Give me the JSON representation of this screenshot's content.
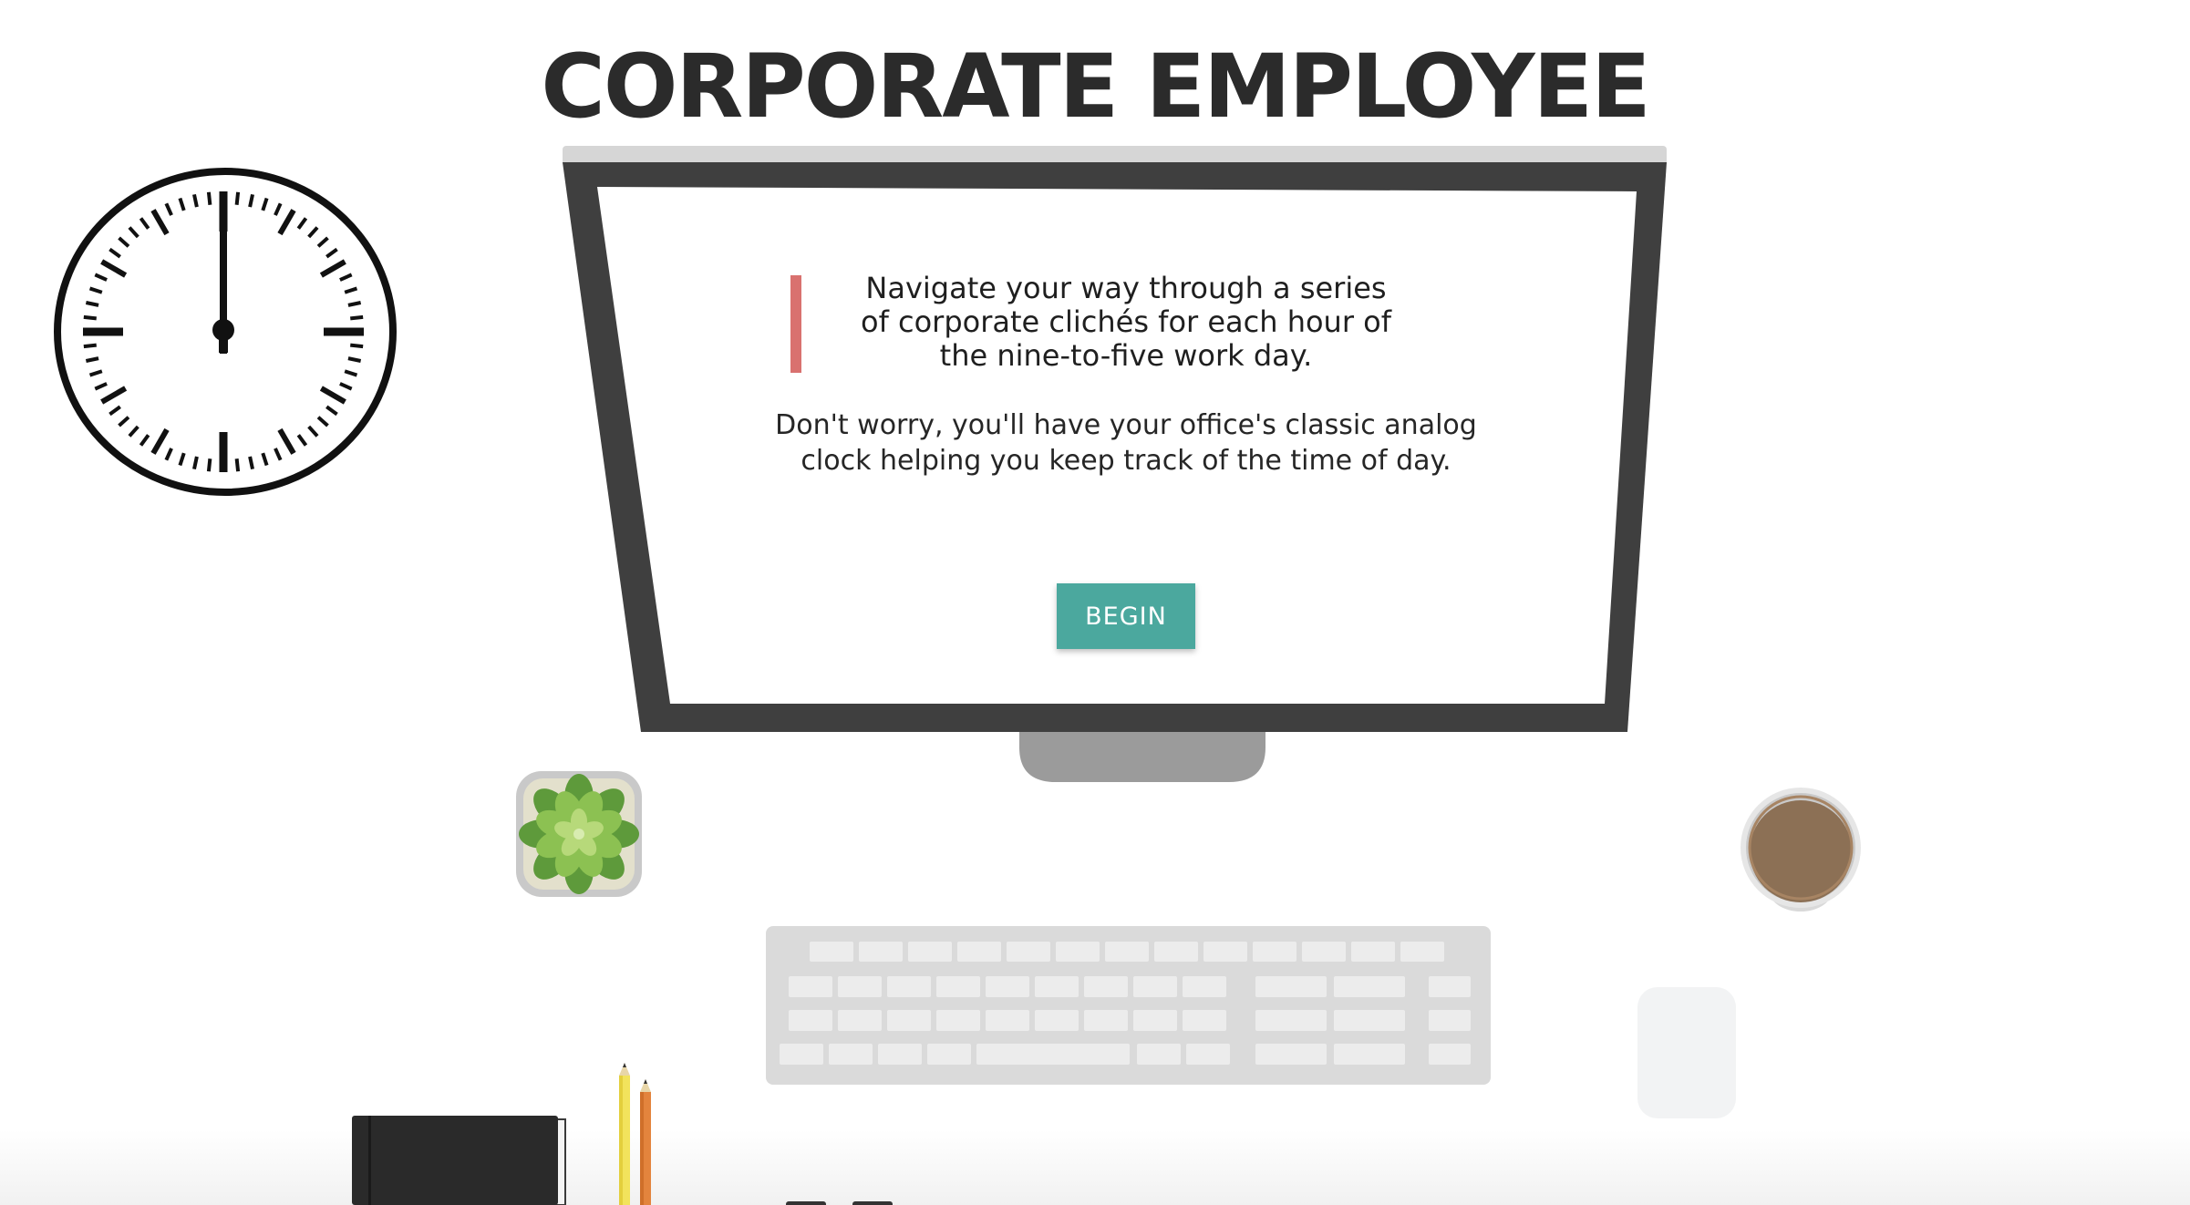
{
  "header": {
    "title": "CORPORATE EMPLOYEE"
  },
  "intro": {
    "headline": "Navigate your way through a series of corporate clichés for each hour of the nine-to-five work day.",
    "subtext": "Don't worry, you'll have your office's classic analog clock helping you keep track of the time of day.",
    "begin_label": "BEGIN"
  },
  "clock": {
    "time": "12:00"
  },
  "colors": {
    "accent": "#d9716f",
    "button": "#4ba89e",
    "monitor_bezel": "#3f3f3f",
    "coffee": "#8c7055"
  },
  "icons": {
    "clock": "wall-clock-icon",
    "plant": "succulent-plant-icon",
    "coffee": "coffee-cup-icon",
    "keyboard": "keyboard-icon",
    "mouse": "mouse-icon",
    "notebook": "notebook-icon",
    "pencils": "pencil-icon"
  }
}
